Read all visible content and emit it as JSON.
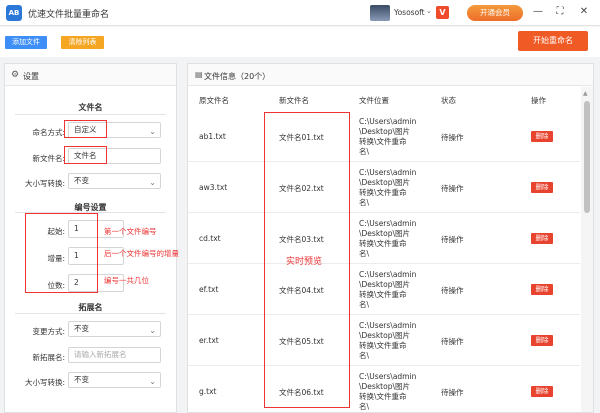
{
  "window": {
    "app_icon_text": "AB",
    "title": "优速文件批量重命名",
    "user_name": "Yososoft",
    "vip_mark": "V",
    "vip_button": "开通会员",
    "minimize": "—",
    "maximize": "⛶",
    "close": "✕"
  },
  "toolbar": {
    "add_files": "添加文件",
    "clear_list": "清除列表",
    "start_rename": "开始重命名"
  },
  "settings": {
    "title": "设置",
    "filename_section": "文件名",
    "naming_label": "命名方式:",
    "naming_value": "自定义",
    "new_name_label": "新文件名:",
    "new_name_value": "文件名",
    "case_label": "大小写转换:",
    "case_value": "不变",
    "numbering_section": "编号设置",
    "start_label": "起始:",
    "start_value": "1",
    "step_label": "增量:",
    "step_value": "1",
    "digits_label": "位数:",
    "digits_value": "2",
    "note_start": "第一个文件编号",
    "note_step": "后一个文件编号的增量",
    "note_digits": "编号一共几位",
    "extension_section": "拓展名",
    "ext_mode_label": "变更方式:",
    "ext_mode_value": "不变",
    "new_ext_label": "新拓展名:",
    "new_ext_placeholder": "请输入新拓展名",
    "ext_case_label": "大小写转换:",
    "ext_case_value": "不变"
  },
  "files": {
    "title": "文件信息（20个）",
    "columns": [
      "原文件名",
      "新文件名",
      "文件位置",
      "状态",
      "操作"
    ],
    "preview_note": "实时预览",
    "rows": [
      {
        "original": "ab1.txt",
        "new": "文件名01.txt",
        "path": [
          "C:\\Users\\admin",
          "\\Desktop\\图片",
          "转换\\文件重命",
          "名\\"
        ],
        "status": "待操作",
        "action": "删除"
      },
      {
        "original": "aw3.txt",
        "new": "文件名02.txt",
        "path": [
          "C:\\Users\\admin",
          "\\Desktop\\图片",
          "转换\\文件重命",
          "名\\"
        ],
        "status": "待操作",
        "action": "删除"
      },
      {
        "original": "cd.txt",
        "new": "文件名03.txt",
        "path": [
          "C:\\Users\\admin",
          "\\Desktop\\图片",
          "转换\\文件重命",
          "名\\"
        ],
        "status": "待操作",
        "action": "删除"
      },
      {
        "original": "ef.txt",
        "new": "文件名04.txt",
        "path": [
          "C:\\Users\\admin",
          "\\Desktop\\图片",
          "转换\\文件重命",
          "名\\"
        ],
        "status": "待操作",
        "action": "删除"
      },
      {
        "original": "er.txt",
        "new": "文件名05.txt",
        "path": [
          "C:\\Users\\admin",
          "\\Desktop\\图片",
          "转换\\文件重命",
          "名\\"
        ],
        "status": "待操作",
        "action": "删除"
      },
      {
        "original": "g.txt",
        "new": "文件名06.txt",
        "path": [
          "C:\\Users\\admin",
          "\\Desktop\\图片",
          "转换\\文件重命",
          "名\\"
        ],
        "status": "待操作",
        "action": "删除"
      }
    ]
  }
}
